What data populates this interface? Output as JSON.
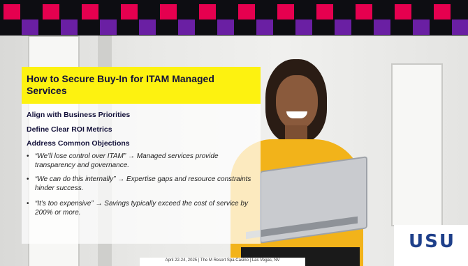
{
  "colors": {
    "accent_yellow": "#fdf210",
    "checker_pink": "#e5004f",
    "checker_purple": "#6a1fa3",
    "checker_dark": "#0d0d12",
    "title_text": "#13113a",
    "logo_blue": "#1e3f8a"
  },
  "slide": {
    "title": "How to Secure Buy-In for ITAM Managed Services",
    "points": [
      "Align with Business Priorities",
      "Define Clear ROI Metrics",
      "Address Common Objections"
    ],
    "objections": [
      {
        "bullet": "•",
        "text": "“We’ll lose control over ITAM” → Managed services provide transparency and governance."
      },
      {
        "bullet": "•",
        "text": "“We can do this internally” → Expertise gaps and resource constraints hinder success."
      },
      {
        "bullet": "•",
        "text": "“It’s too expensive” → Savings typically exceed the cost of service by 200% or more."
      }
    ]
  },
  "footer": {
    "event": "April 22-24, 2025 | The M Resort Spa Casino | Las Vegas, NV"
  },
  "logo": {
    "text": "USU"
  }
}
